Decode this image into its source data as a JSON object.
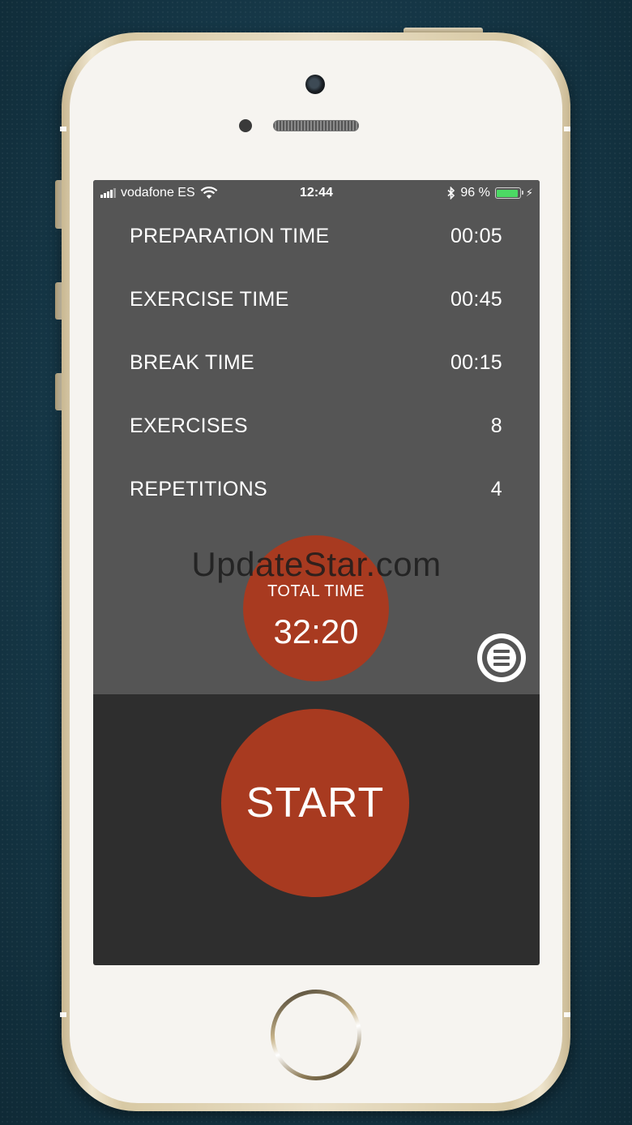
{
  "status_bar": {
    "carrier": "vodafone ES",
    "time": "12:44",
    "battery_text": "96 %",
    "battery_level": 0.96,
    "signal_icon": "signal-bars-icon",
    "wifi_icon": "wifi-icon",
    "bluetooth_icon": "bluetooth-icon",
    "charging_icon": "charging-bolt-icon"
  },
  "settings": [
    {
      "label": "PREPARATION TIME",
      "value": "00:05"
    },
    {
      "label": "EXERCISE TIME",
      "value": "00:45"
    },
    {
      "label": "BREAK TIME",
      "value": "00:15"
    },
    {
      "label": "EXERCISES",
      "value": "8"
    },
    {
      "label": "REPETITIONS",
      "value": "4"
    }
  ],
  "total": {
    "label": "TOTAL TIME",
    "value": "32:20"
  },
  "watermark": "UpdateStar.com",
  "menu_icon": "menu-list-icon",
  "start_label": "START",
  "colors": {
    "accent": "#a83a20",
    "top_panel": "#555555",
    "bottom_panel": "#2e2e2e",
    "text": "#ffffff",
    "battery": "#4cd964"
  }
}
